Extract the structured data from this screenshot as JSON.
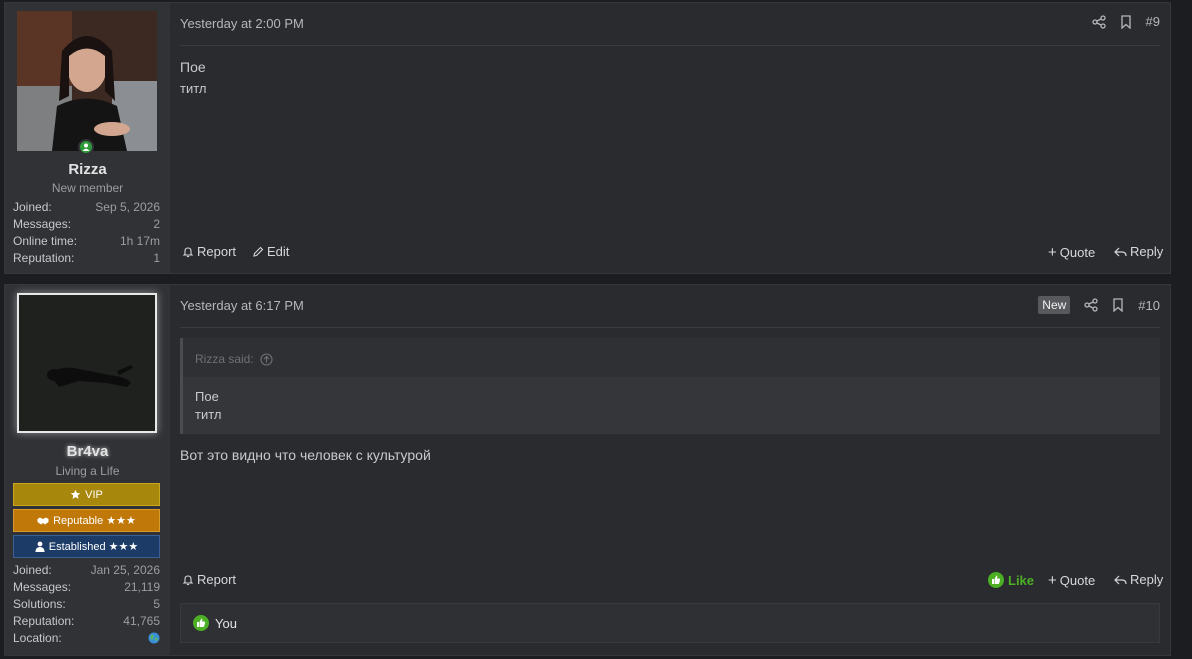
{
  "posts": [
    {
      "author": {
        "name": "Rizza",
        "title": "New member",
        "stats": [
          {
            "label": "Joined:",
            "value": "Sep 5, 2026"
          },
          {
            "label": "Messages:",
            "value": "2"
          },
          {
            "label": "Online time:",
            "value": "1h 17m"
          },
          {
            "label": "Reputation:",
            "value": "1"
          }
        ]
      },
      "date": "Yesterday at 2:00 PM",
      "number": "#9",
      "content_lines": [
        "Пое",
        "титл"
      ],
      "actions": {
        "report": "Report",
        "edit": "Edit",
        "quote": "Quote",
        "reply": "Reply"
      }
    },
    {
      "author": {
        "name": "Br4va",
        "title": "Living a Life",
        "ranks": [
          {
            "label": "VIP",
            "color": "#b8860b"
          },
          {
            "label": "Reputable ★★★",
            "color": "#c47a0a"
          },
          {
            "label": "Established ★★★",
            "color": "#1f3f6e"
          }
        ],
        "stats": [
          {
            "label": "Joined:",
            "value": "Jan 25, 2026"
          },
          {
            "label": "Messages:",
            "value": "21,119"
          },
          {
            "label": "Solutions:",
            "value": "5"
          },
          {
            "label": "Reputation:",
            "value": "41,765"
          },
          {
            "label": "Location:",
            "value": ""
          }
        ]
      },
      "date": "Yesterday at 6:17 PM",
      "new_badge": "New",
      "number": "#10",
      "quote": {
        "author_line": "Rizza said:",
        "lines": [
          "Пое",
          "титл"
        ]
      },
      "content": "Вот это видно что человек с культурой",
      "actions": {
        "report": "Report",
        "like": "Like",
        "quote": "Quote",
        "reply": "Reply"
      },
      "likes_summary": "You"
    }
  ],
  "colors": {
    "like_green": "#4caf24",
    "online_green": "#2e9b3a"
  }
}
